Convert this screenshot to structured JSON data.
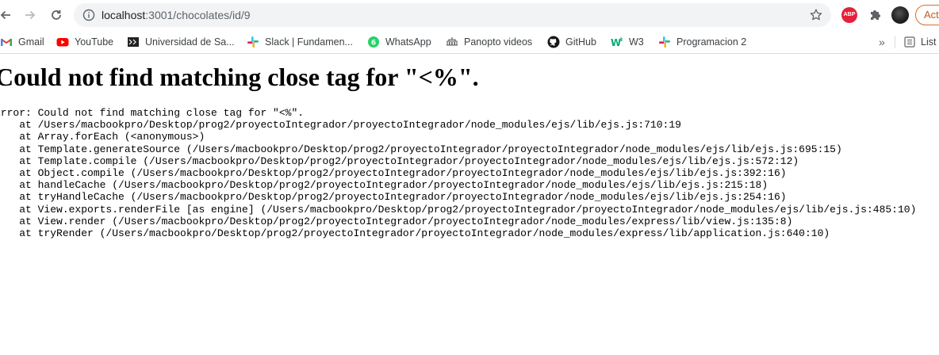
{
  "browser": {
    "url_host": "localhost",
    "url_path": ":3001/chocolates/id/9",
    "extension_abp_label": "ABP",
    "profile_button_label": "Actualizar",
    "icons": {
      "back": "back-arrow-icon",
      "forward": "forward-arrow-icon",
      "reload": "reload-icon",
      "site_info": "info-icon",
      "bookmark_star": "star-icon",
      "extensions": "puzzle-icon"
    }
  },
  "bookmarks": {
    "items": [
      {
        "label": "Gmail",
        "icon": "gmail-icon"
      },
      {
        "label": "YouTube",
        "icon": "youtube-icon"
      },
      {
        "label": "Universidad de Sa...",
        "icon": "university-icon"
      },
      {
        "label": "Slack | Fundamen...",
        "icon": "slack-icon"
      },
      {
        "label": "WhatsApp",
        "icon": "whatsapp-icon"
      },
      {
        "label": "Panopto videos",
        "icon": "panopto-icon"
      },
      {
        "label": "GitHub",
        "icon": "github-icon"
      },
      {
        "label": "W3",
        "icon": "w3-icon"
      },
      {
        "label": "Programacion 2",
        "icon": "slack-icon"
      }
    ],
    "overflow_label": "»",
    "reading_list_label": "List"
  },
  "page": {
    "title": "Could not find matching close tag for \"<%\".",
    "stack_lines": [
      "Error: Could not find matching close tag for \"<%\".",
      "    at /Users/macbookpro/Desktop/prog2/proyectoIntegrador/proyectoIntegrador/node_modules/ejs/lib/ejs.js:710:19",
      "    at Array.forEach (<anonymous>)",
      "    at Template.generateSource (/Users/macbookpro/Desktop/prog2/proyectoIntegrador/proyectoIntegrador/node_modules/ejs/lib/ejs.js:695:15)",
      "    at Template.compile (/Users/macbookpro/Desktop/prog2/proyectoIntegrador/proyectoIntegrador/node_modules/ejs/lib/ejs.js:572:12)",
      "    at Object.compile (/Users/macbookpro/Desktop/prog2/proyectoIntegrador/proyectoIntegrador/node_modules/ejs/lib/ejs.js:392:16)",
      "    at handleCache (/Users/macbookpro/Desktop/prog2/proyectoIntegrador/proyectoIntegrador/node_modules/ejs/lib/ejs.js:215:18)",
      "    at tryHandleCache (/Users/macbookpro/Desktop/prog2/proyectoIntegrador/proyectoIntegrador/node_modules/ejs/lib/ejs.js:254:16)",
      "    at View.exports.renderFile [as engine] (/Users/macbookpro/Desktop/prog2/proyectoIntegrador/proyectoIntegrador/node_modules/ejs/lib/ejs.js:485:10)",
      "    at View.render (/Users/macbookpro/Desktop/prog2/proyectoIntegrador/proyectoIntegrador/node_modules/express/lib/view.js:135:8)",
      "    at tryRender (/Users/macbookpro/Desktop/prog2/proyectoIntegrador/proyectoIntegrador/node_modules/express/lib/application.js:640:10)"
    ]
  },
  "colors": {
    "omnibox_bg": "#f1f3f4",
    "abp_red": "#e5203b",
    "profile_orange": "#c5581b",
    "text": "#000000"
  }
}
